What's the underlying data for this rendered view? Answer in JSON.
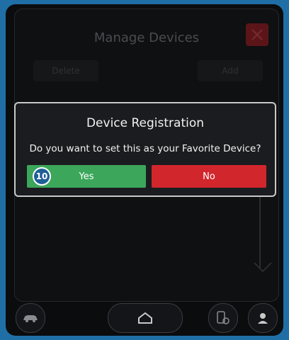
{
  "screen": {
    "title": "Manage Devices",
    "buttons": {
      "delete_label": "Delete",
      "add_label": "Add"
    }
  },
  "dialog": {
    "title": "Device Registration",
    "message": "Do you want to set this as your Favorite Device?",
    "yes_label": "Yes",
    "no_label": "No",
    "step_badge": "10"
  },
  "bottom_bar": {
    "icons": [
      "car-icon",
      "home-icon",
      "phone-settings-icon",
      "user-icon"
    ]
  },
  "colors": {
    "frame": "#1f6fa6",
    "yes": "#3ca75b",
    "no": "#d2262d",
    "close_bg": "#5b1519",
    "badge": "#1f5f97"
  }
}
